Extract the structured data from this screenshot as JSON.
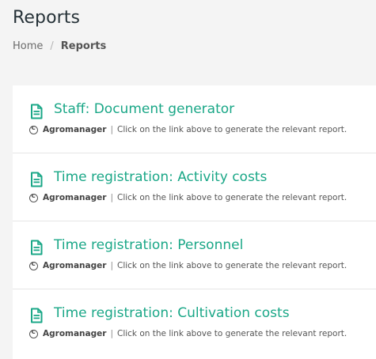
{
  "page": {
    "title": "Reports"
  },
  "breadcrumb": {
    "home": "Home",
    "separator": "/",
    "current": "Reports"
  },
  "reports": {
    "items": [
      {
        "title": "Staff: Document generator",
        "author": "Agromanager",
        "description": "Click on the link above to generate the relevant report."
      },
      {
        "title": "Time registration: Activity costs",
        "author": "Agromanager",
        "description": "Click on the link above to generate the relevant report."
      },
      {
        "title": "Time registration: Personnel",
        "author": "Agromanager",
        "description": "Click on the link above to generate the relevant report."
      },
      {
        "title": "Time registration: Cultivation costs",
        "author": "Agromanager",
        "description": "Click on the link above to generate the relevant report."
      }
    ],
    "meta_separator": "|",
    "icon": "file-text-icon",
    "accent_color": "#1aa787"
  }
}
